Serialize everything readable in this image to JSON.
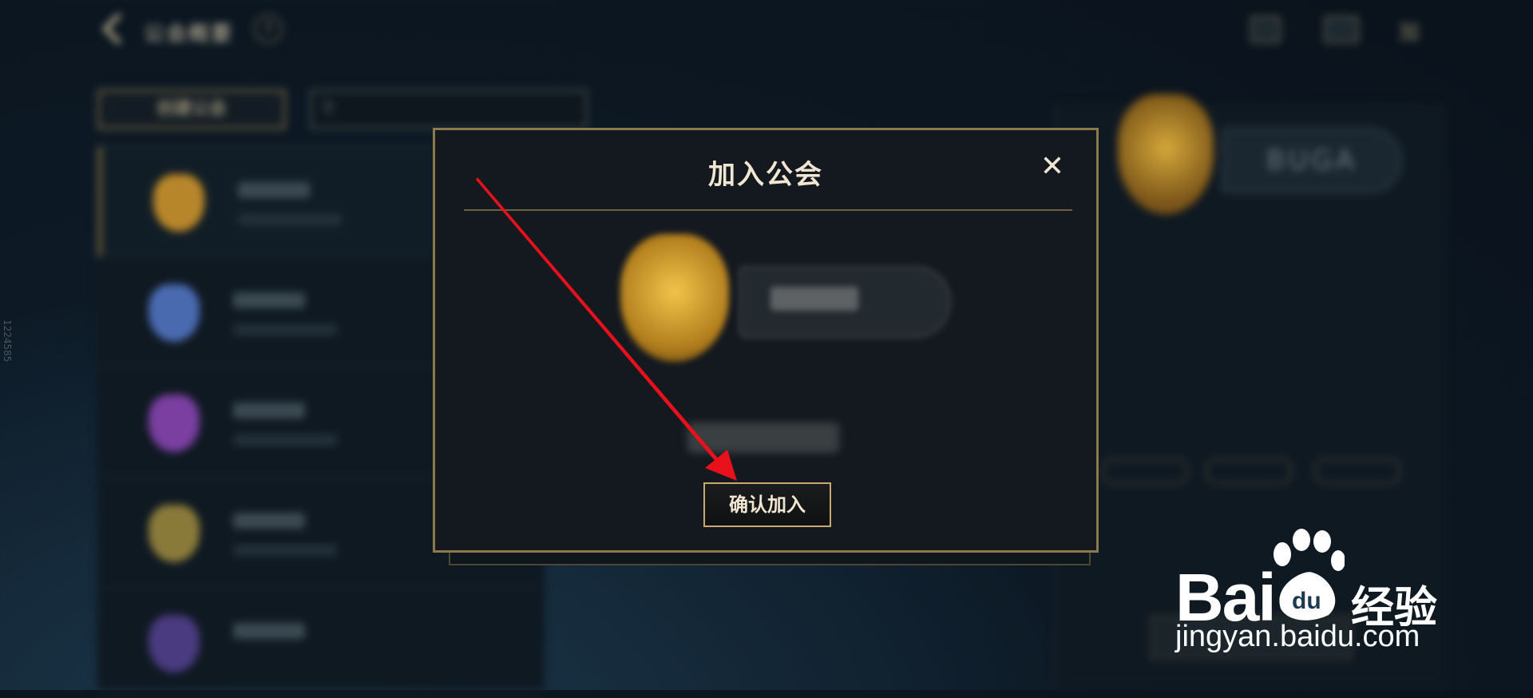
{
  "top_bar": {
    "title": "公会概要",
    "help_label": "?",
    "right_text": "加"
  },
  "left_panel": {
    "tab_label": "创建公会",
    "search_placeholder": "",
    "guilds": [
      {
        "emblem_color": "#b8862a",
        "active": true
      },
      {
        "emblem_color": "#4a6ab0",
        "active": false
      },
      {
        "emblem_color": "#7a3fa0",
        "active": false
      },
      {
        "emblem_color": "#8a7a3a",
        "active": false
      },
      {
        "emblem_color": "#4a3a80",
        "active": false
      }
    ]
  },
  "right_panel": {
    "guild_name": "BUGA"
  },
  "modal": {
    "title": "加入公会",
    "close_label": "✕",
    "confirm_label": "确认加入"
  },
  "watermark": {
    "bai": "Bai",
    "du": "du",
    "jingyan": "经验",
    "url": "jingyan.baidu.com"
  },
  "side_id": "1224585",
  "colors": {
    "gold": "#c8aa6e",
    "title_text": "#f0e6d2",
    "arrow": "#e8101a"
  }
}
